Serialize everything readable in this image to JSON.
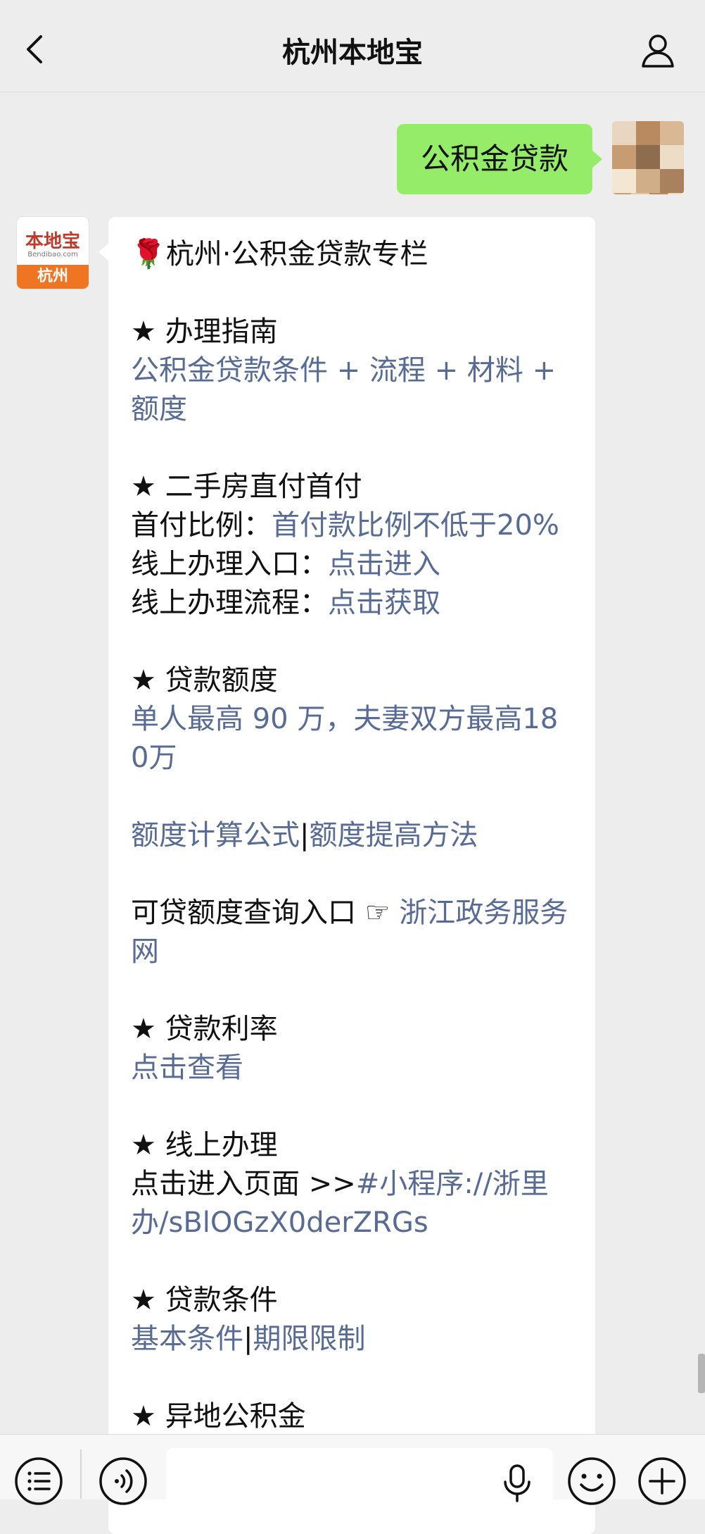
{
  "header": {
    "title": "杭州本地宝"
  },
  "sent_message": {
    "text": "公积金贷款"
  },
  "bot": {
    "avatar_logo": "本地宝",
    "avatar_sub": "Bendibao.com",
    "avatar_city": "杭州"
  },
  "reply": {
    "title": "杭州·公积金贷款专栏",
    "title_icon": "🌹",
    "sections": {
      "guide": {
        "heading": "★ 办理指南",
        "link": "公积金贷款条件 + 流程 + 材料 + 额度"
      },
      "second_hand": {
        "heading": "★ 二手房直付首付",
        "ratio_label": "首付比例：",
        "ratio_link": "首付款比例不低于20%",
        "entry_label": "线上办理入口：",
        "entry_link": "点击进入",
        "process_label": "线上办理流程：",
        "process_link": "点击获取"
      },
      "quota": {
        "heading": "★ 贷款额度",
        "link": "单人最高 90 万，夫妻双方最高180万",
        "formula_link": "额度计算公式",
        "separator": "|",
        "raise_link": "额度提高方法",
        "query_label": "可贷额度查询入口",
        "query_icon": "☞",
        "query_link": "浙江政务服务网"
      },
      "rate": {
        "heading": "★ 贷款利率",
        "link": "点击查看"
      },
      "online": {
        "heading": "★ 线上办理",
        "label": "点击进入页面 >>",
        "link": "#小程序://浙里办/sBlOGzX0derZRGs"
      },
      "conditions": {
        "heading": "★ 贷款条件",
        "basic_link": "基本条件",
        "separator": "|",
        "term_link": "期限限制"
      },
      "remote": {
        "heading": "★ 异地公积金"
      }
    }
  },
  "input_bar": {
    "placeholder": ""
  },
  "colors": {
    "background": "#ededed",
    "sent_bubble": "#95ec69",
    "link": "#576b95",
    "brand_orange": "#f07522"
  }
}
